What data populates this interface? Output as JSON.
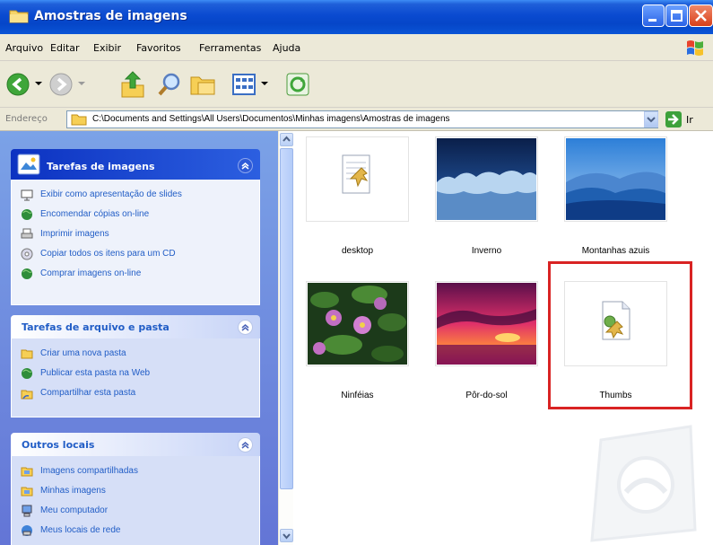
{
  "window": {
    "title": "Amostras de imagens"
  },
  "menu": {
    "items": [
      {
        "label": "Arquivo"
      },
      {
        "label": "Editar"
      },
      {
        "label": "Exibir"
      },
      {
        "label": "Favoritos"
      },
      {
        "label": "Ferramentas"
      },
      {
        "label": "Ajuda"
      }
    ]
  },
  "toolbar": {
    "icons": [
      "back-icon",
      "forward-icon",
      "up-folder-icon",
      "search-icon",
      "folders-icon",
      "views-icon",
      "sync-icon"
    ]
  },
  "address": {
    "label": "Endereço",
    "value": "C:\\Documents and Settings\\All Users\\Documentos\\Minhas imagens\\Amostras de imagens",
    "go_label": "Ir"
  },
  "left_pane": {
    "picture_tasks": {
      "title": "Tarefas de imagens",
      "items": [
        {
          "label": "Exibir como apresentação de slides",
          "icon": "slideshow-icon"
        },
        {
          "label": "Encomendar cópias on-line",
          "icon": "globe-icon"
        },
        {
          "label": "Imprimir imagens",
          "icon": "printer-icon"
        },
        {
          "label": "Copiar todos os itens para um CD",
          "icon": "cd-icon"
        },
        {
          "label": "Comprar imagens on-line",
          "icon": "globe-icon"
        }
      ]
    },
    "file_tasks": {
      "title": "Tarefas de arquivo e pasta",
      "items": [
        {
          "label": "Criar uma nova pasta",
          "icon": "new-folder-icon"
        },
        {
          "label": "Publicar esta pasta na Web",
          "icon": "globe-icon"
        },
        {
          "label": "Compartilhar esta pasta",
          "icon": "share-icon"
        }
      ]
    },
    "other_places": {
      "title": "Outros locais",
      "items": [
        {
          "label": "Imagens compartilhadas",
          "icon": "folder-icon"
        },
        {
          "label": "Minhas imagens",
          "icon": "folder-icon"
        },
        {
          "label": "Meu computador",
          "icon": "computer-icon"
        },
        {
          "label": "Meus locais de rede",
          "icon": "network-icon"
        }
      ]
    }
  },
  "files": [
    {
      "name": "desktop",
      "kind": "settings-file-icon"
    },
    {
      "name": "Inverno",
      "kind": "image"
    },
    {
      "name": "Montanhas azuis",
      "kind": "image"
    },
    {
      "name": "Ninféias",
      "kind": "image"
    },
    {
      "name": "Pôr-do-sol",
      "kind": "image"
    },
    {
      "name": "Thumbs",
      "kind": "thumbs-db-icon",
      "highlighted": true
    }
  ],
  "colors": {
    "titlebar": "#0a4ad0",
    "highlight": "#d92323",
    "link": "#215dc6"
  }
}
